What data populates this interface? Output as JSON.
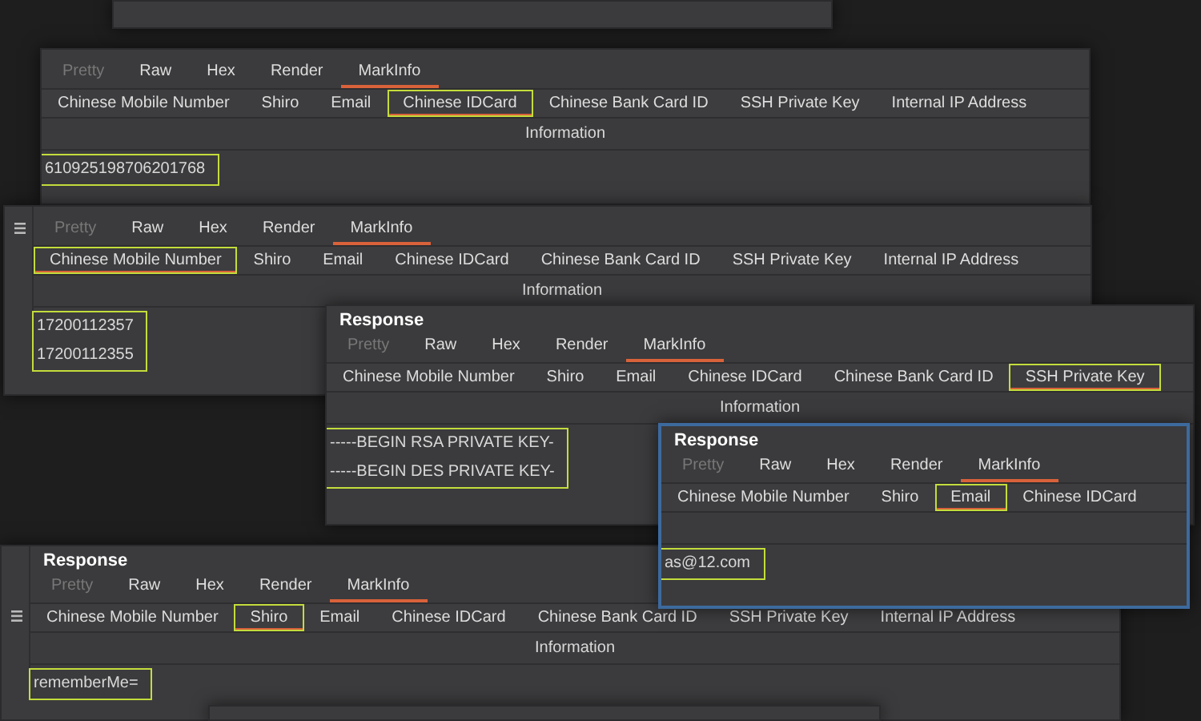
{
  "panels": [
    {
      "kind": "frame"
    },
    {
      "kind": "response",
      "focused": false,
      "menu_icon": false,
      "tabs": [
        {
          "label": "Pretty",
          "selected": false,
          "disabled": true
        },
        {
          "label": "Raw",
          "selected": false,
          "disabled": false
        },
        {
          "label": "Hex",
          "selected": false,
          "disabled": false
        },
        {
          "label": "Render",
          "selected": false,
          "disabled": false
        },
        {
          "label": "MarkInfo",
          "selected": true,
          "disabled": false
        }
      ],
      "subtabs": [
        {
          "label": "Chinese Mobile Number",
          "selected": false
        },
        {
          "label": "Shiro",
          "selected": false
        },
        {
          "label": "Email",
          "selected": false
        },
        {
          "label": "Chinese IDCard",
          "selected": true
        },
        {
          "label": "Chinese Bank Card ID",
          "selected": false
        },
        {
          "label": "SSH Private Key",
          "selected": false
        },
        {
          "label": "Internal IP Address",
          "selected": false
        }
      ],
      "header": "Information",
      "rows_highlighted": true,
      "rows": [
        "610925198706201768"
      ]
    },
    {
      "kind": "response",
      "focused": false,
      "menu_icon": true,
      "tabs": [
        {
          "label": "Pretty",
          "selected": false,
          "disabled": true
        },
        {
          "label": "Raw",
          "selected": false,
          "disabled": false
        },
        {
          "label": "Hex",
          "selected": false,
          "disabled": false
        },
        {
          "label": "Render",
          "selected": false,
          "disabled": false
        },
        {
          "label": "MarkInfo",
          "selected": true,
          "disabled": false
        }
      ],
      "subtabs": [
        {
          "label": "Chinese Mobile Number",
          "selected": true
        },
        {
          "label": "Shiro",
          "selected": false
        },
        {
          "label": "Email",
          "selected": false
        },
        {
          "label": "Chinese IDCard",
          "selected": false
        },
        {
          "label": "Chinese Bank Card ID",
          "selected": false
        },
        {
          "label": "SSH Private Key",
          "selected": false
        },
        {
          "label": "Internal IP Address",
          "selected": false
        }
      ],
      "header": "Information",
      "rows_highlighted": true,
      "rows": [
        "17200112357",
        "17200112355"
      ]
    },
    {
      "kind": "response",
      "title": "Response",
      "focused": false,
      "menu_icon": false,
      "tabs": [
        {
          "label": "Pretty",
          "selected": false,
          "disabled": true
        },
        {
          "label": "Raw",
          "selected": false,
          "disabled": false
        },
        {
          "label": "Hex",
          "selected": false,
          "disabled": false
        },
        {
          "label": "Render",
          "selected": false,
          "disabled": false
        },
        {
          "label": "MarkInfo",
          "selected": true,
          "disabled": false
        }
      ],
      "subtabs": [
        {
          "label": "Chinese Mobile Number",
          "selected": false
        },
        {
          "label": "Shiro",
          "selected": false
        },
        {
          "label": "Email",
          "selected": false
        },
        {
          "label": "Chinese IDCard",
          "selected": false
        },
        {
          "label": "Chinese Bank Card ID",
          "selected": false
        },
        {
          "label": "SSH Private Key",
          "selected": true
        }
      ],
      "header": "Information",
      "rows_highlighted": true,
      "rows": [
        "-----BEGIN RSA PRIVATE KEY-",
        "-----BEGIN DES PRIVATE KEY-"
      ]
    },
    {
      "kind": "response",
      "title": "Response",
      "focused": true,
      "menu_icon": false,
      "tabs": [
        {
          "label": "Pretty",
          "selected": false,
          "disabled": true
        },
        {
          "label": "Raw",
          "selected": false,
          "disabled": false
        },
        {
          "label": "Hex",
          "selected": false,
          "disabled": false
        },
        {
          "label": "Render",
          "selected": false,
          "disabled": false
        },
        {
          "label": "MarkInfo",
          "selected": true,
          "disabled": false
        }
      ],
      "subtabs": [
        {
          "label": "Chinese Mobile Number",
          "selected": false
        },
        {
          "label": "Shiro",
          "selected": false
        },
        {
          "label": "Email",
          "selected": true
        },
        {
          "label": "Chinese IDCard",
          "selected": false
        }
      ],
      "rows_highlighted": true,
      "rows": [
        "as@12.com"
      ]
    },
    {
      "kind": "response",
      "title": "Response",
      "focused": false,
      "menu_icon": true,
      "tabs": [
        {
          "label": "Pretty",
          "selected": false,
          "disabled": true
        },
        {
          "label": "Raw",
          "selected": false,
          "disabled": false
        },
        {
          "label": "Hex",
          "selected": false,
          "disabled": false
        },
        {
          "label": "Render",
          "selected": false,
          "disabled": false
        },
        {
          "label": "MarkInfo",
          "selected": true,
          "disabled": false
        }
      ],
      "subtabs": [
        {
          "label": "Chinese Mobile Number",
          "selected": false
        },
        {
          "label": "Shiro",
          "selected": true
        },
        {
          "label": "Email",
          "selected": false
        },
        {
          "label": "Chinese IDCard",
          "selected": false
        },
        {
          "label": "Chinese Bank Card ID",
          "selected": false
        },
        {
          "label": "SSH Private Key",
          "selected": false
        },
        {
          "label": "Internal IP Address",
          "selected": false
        }
      ],
      "header": "Information",
      "rows_highlighted": true,
      "rows": [
        "rememberMe="
      ]
    },
    {
      "kind": "frame"
    }
  ]
}
